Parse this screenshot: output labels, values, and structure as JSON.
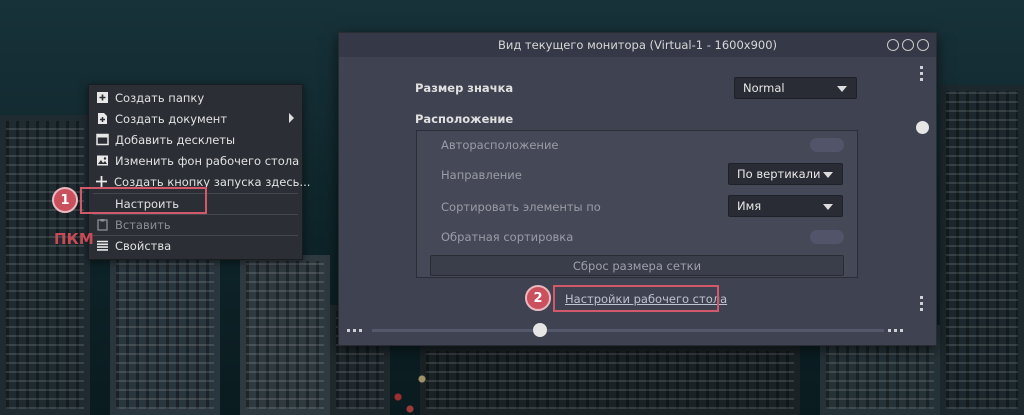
{
  "context_menu": {
    "items": [
      {
        "label": "Создать папку",
        "icon": "folder-plus-icon"
      },
      {
        "label": "Создать документ",
        "icon": "document-plus-icon",
        "submenu": true
      },
      {
        "label": "Добавить десклеты",
        "icon": "desklets-icon"
      },
      {
        "label": "Изменить фон рабочего стола",
        "icon": "image-icon"
      },
      {
        "label": "Создать кнопку запуска здесь...",
        "icon": "plus-icon"
      },
      {
        "label": "Настроить",
        "icon": "none"
      },
      {
        "label": "Вставить",
        "icon": "clipboard-icon",
        "disabled": true
      },
      {
        "label": "Свойства",
        "icon": "list-icon"
      }
    ]
  },
  "annotations": {
    "badge1": "1",
    "badge2": "2",
    "pkm": "ПКМ",
    "highlight_color": "#d2596a"
  },
  "dialog": {
    "title": "Вид текущего монитора (Virtual-1 - 1600x900)",
    "icon_size": {
      "label": "Размер значка",
      "value": "Normal"
    },
    "arrangement": {
      "label": "Расположение",
      "auto_arrange_label": "Авторасположение",
      "auto_arrange_on": false,
      "direction_label": "Направление",
      "direction_value": "По вертикали",
      "sort_label": "Сортировать элементы по",
      "sort_value": "Имя",
      "reverse_label": "Обратная сортировка",
      "reverse_on": false,
      "reset_button": "Сброс размера сетки"
    },
    "desktop_settings_link": "Настройки рабочего стола"
  }
}
